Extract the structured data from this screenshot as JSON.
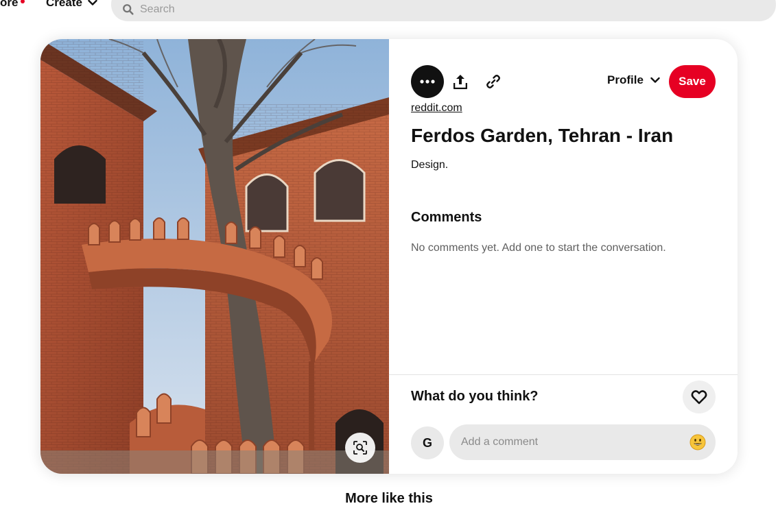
{
  "nav": {
    "explore_label": "ore",
    "create_label": "Create",
    "search_placeholder": "Search",
    "notification_color": "#e60023"
  },
  "pin": {
    "image_alt": "Red brick building with arched spiral staircase around a large tree",
    "actions": {
      "more_icon": "ellipsis-icon",
      "share_icon": "share-upload-icon",
      "link_icon": "link-icon"
    },
    "profile_label": "Profile",
    "save_label": "Save",
    "source": "reddit.com",
    "title": "Ferdos Garden, Tehran - Iran",
    "description": "Design.",
    "accent_color": "#e60023"
  },
  "comments": {
    "heading": "Comments",
    "empty_text": "No comments yet. Add one to start the conversation."
  },
  "composer": {
    "prompt": "What do you think?",
    "avatar_initial": "G",
    "placeholder": "Add a comment",
    "emoji_icon": "smiley-emoji-icon"
  },
  "related": {
    "heading": "More like this"
  }
}
